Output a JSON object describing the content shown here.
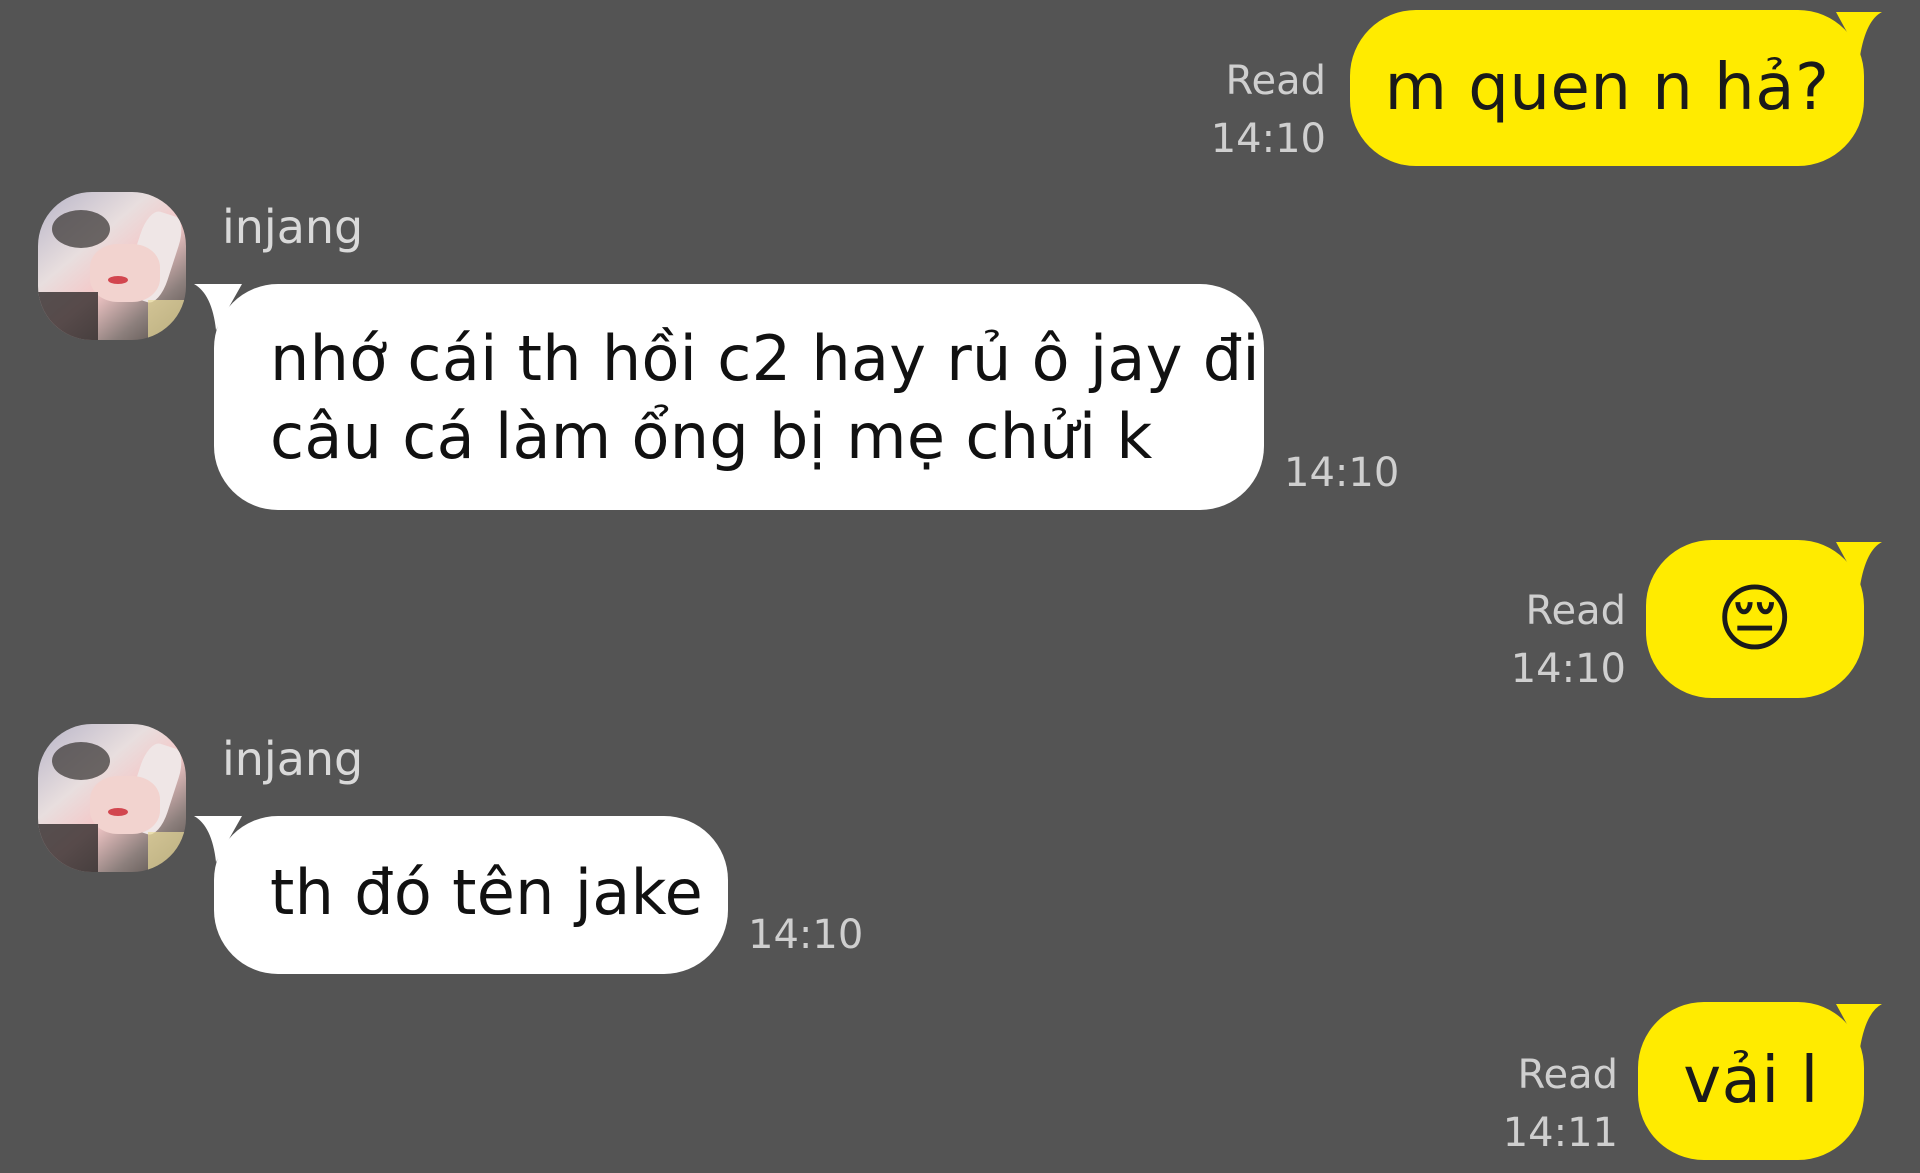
{
  "colors": {
    "background": "#545454",
    "sent_bubble": "#FFEB00",
    "received_bubble": "#FFFFFF",
    "meta_text": "#CFCFCF",
    "sender_name": "#D9D9D9"
  },
  "messages": [
    {
      "direction": "sent",
      "text": "m quen n hả?",
      "status": "Read",
      "time": "14:10"
    },
    {
      "direction": "received",
      "sender": "injang",
      "avatar_icon": "profile-photo",
      "lines": [
        "nhớ cái th hồi c2 hay rủ ô jay đi",
        "câu cá làm ổng bị mẹ chửi k"
      ],
      "time": "14:10"
    },
    {
      "direction": "sent",
      "text": "😔",
      "status": "Read",
      "time": "14:10"
    },
    {
      "direction": "received",
      "sender": "injang",
      "avatar_icon": "profile-photo",
      "lines": [
        "th đó tên jake"
      ],
      "time": "14:10"
    },
    {
      "direction": "sent",
      "text": "vải l",
      "status": "Read",
      "time": "14:11"
    }
  ]
}
